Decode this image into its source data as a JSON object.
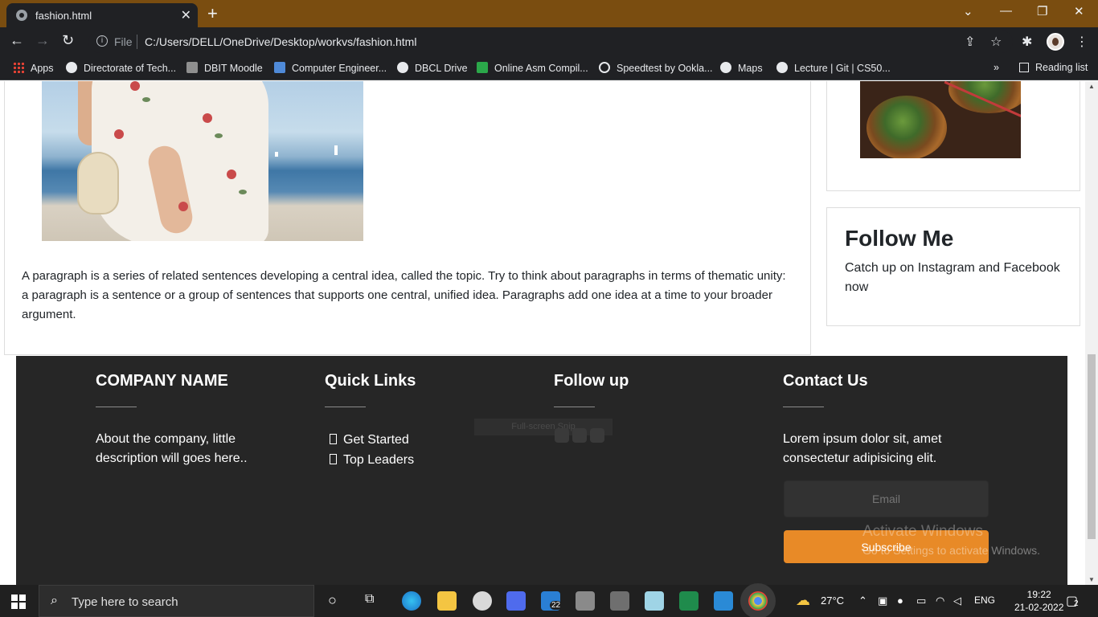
{
  "browser": {
    "tab_title": "fashion.html",
    "address_label": "File",
    "url": "C:/Users/DELL/OneDrive/Desktop/workvs/fashion.html",
    "bookmarks": [
      {
        "label": "Apps",
        "icon": "apps-grid-icon"
      },
      {
        "label": "Directorate of Tech...",
        "icon": "globe-icon"
      },
      {
        "label": "DBIT Moodle",
        "icon": "moodle-icon"
      },
      {
        "label": "Computer Engineer...",
        "icon": "diamond-icon"
      },
      {
        "label": "DBCL Drive",
        "icon": "globe-icon"
      },
      {
        "label": "Online Asm Compil...",
        "icon": "code-icon"
      },
      {
        "label": "Speedtest by Ookla...",
        "icon": "gauge-icon"
      },
      {
        "label": "Maps",
        "icon": "globe-icon"
      },
      {
        "label": "Lecture | Git | CS50...",
        "icon": "globe-icon"
      }
    ],
    "more_bookmarks": "»",
    "reading_list": "Reading list"
  },
  "page": {
    "paragraph": "A paragraph is a series of related sentences developing a central idea, called the topic. Try to think about paragraphs in terms of thematic unity: a paragraph is a sentence or a group of sentences that supports one central, unified idea. Paragraphs add one idea at a time to your broader argument.",
    "follow_card": {
      "title": "Follow Me",
      "text": "Catch up on Instagram and Facebook now"
    },
    "footer": {
      "company": {
        "title": "COMPANY NAME",
        "text": "About the company, little description will goes here.."
      },
      "quick_links": {
        "title": "Quick Links",
        "items": [
          "Get Started",
          "Top Leaders"
        ]
      },
      "follow_up": {
        "title": "Follow up"
      },
      "contact": {
        "title": "Contact Us",
        "text": "Lorem ipsum dolor sit, amet consectetur adipisicing elit.",
        "email_placeholder": "Email",
        "subscribe_label": "Subscribe"
      }
    },
    "overlay": {
      "snip_label": "Full-screen Snip",
      "watermark_title": "Activate Windows",
      "watermark_text": "Go to Settings to activate Windows."
    }
  },
  "taskbar": {
    "search_placeholder": "Type here to search",
    "weather": "27°C",
    "language": "ENG",
    "time": "19:22",
    "date": "21-02-2022",
    "mail_badge": "22",
    "notification_badge": "2"
  }
}
